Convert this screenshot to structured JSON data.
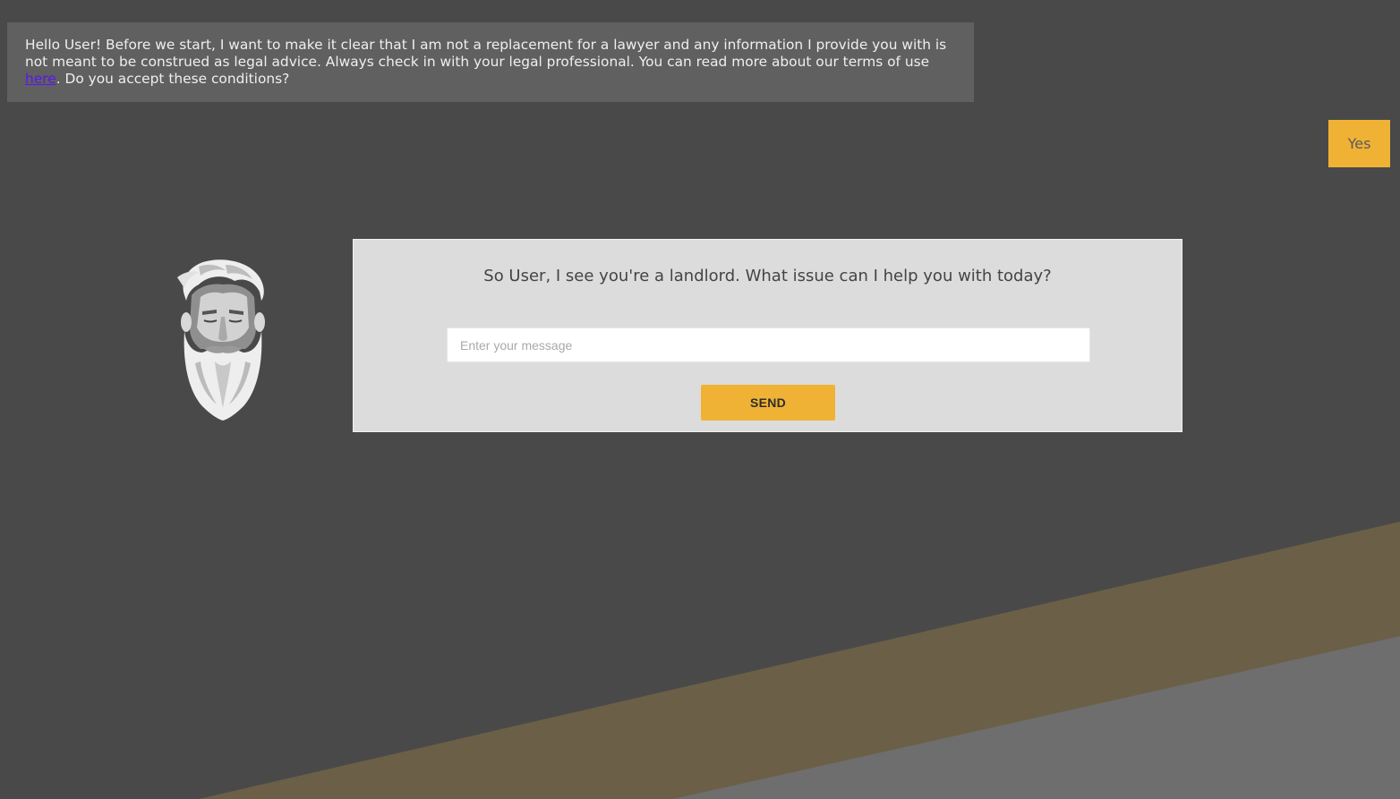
{
  "colors": {
    "background": "#494949",
    "accent": "#f0b234",
    "bot_bubble": "#5f605f",
    "card": "#dcdcdc",
    "link": "#5a16ee",
    "stripe_gold": "#6b5f48",
    "stripe_gray": "#6e6e6e"
  },
  "bot_message": {
    "text_before_link": "Hello User! Before we start, I want to make it clear that I am not a replacement for a lawyer and any information I provide you with is not meant to be construed as legal advice. Always check in with your legal professional. You can read more about our terms of use ",
    "link_text": "here",
    "text_after_link": ". Do you accept these conditions?"
  },
  "user_reply": {
    "label": "Yes"
  },
  "avatar": {
    "icon": "bearded-man-avatar-icon"
  },
  "chat_card": {
    "question": "So User, I see you're a landlord. What issue can I help you with today?",
    "input_value": "",
    "input_placeholder": "Enter your message",
    "send_label": "SEND"
  }
}
